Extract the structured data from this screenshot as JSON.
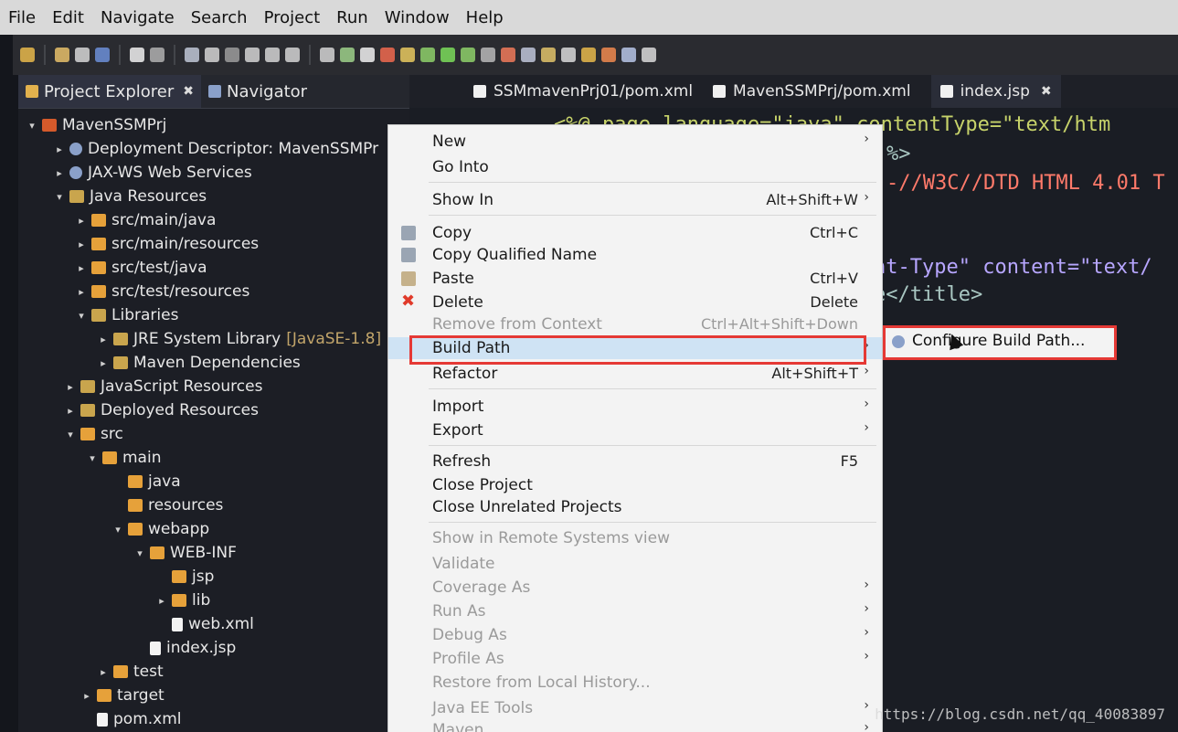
{
  "menubar": [
    "File",
    "Edit",
    "Navigate",
    "Search",
    "Project",
    "Run",
    "Window",
    "Help"
  ],
  "left_tabs": [
    {
      "label": "Project Explorer",
      "active": true,
      "close": "✖"
    },
    {
      "label": "Navigator",
      "active": false
    }
  ],
  "tree": [
    {
      "label": "MavenSSMPrj",
      "level": 0,
      "twisty": "▾",
      "icon": "project-icon"
    },
    {
      "label": "Deployment Descriptor: MavenSSMPr",
      "level": 1,
      "twisty": "▸",
      "icon": "gear-icon"
    },
    {
      "label": "JAX-WS Web Services",
      "level": 1,
      "twisty": "▸",
      "icon": "gear-icon"
    },
    {
      "label": "Java Resources",
      "level": 1,
      "twisty": "▾",
      "icon": "library-icon"
    },
    {
      "label": "src/main/java",
      "level": 2,
      "twisty": "▸",
      "icon": "package-folder-icon"
    },
    {
      "label": "src/main/resources",
      "level": 2,
      "twisty": "▸",
      "icon": "package-folder-icon"
    },
    {
      "label": "src/test/java",
      "level": 2,
      "twisty": "▸",
      "icon": "package-folder-icon"
    },
    {
      "label": "src/test/resources",
      "level": 2,
      "twisty": "▸",
      "icon": "package-folder-icon"
    },
    {
      "label": "Libraries",
      "level": 2,
      "twisty": "▾",
      "icon": "library-icon"
    },
    {
      "label": "JRE System Library",
      "suffix": " [JavaSE-1.8]",
      "level": 3,
      "twisty": "▸",
      "icon": "library-icon"
    },
    {
      "label": "Maven Dependencies",
      "level": 3,
      "twisty": "▸",
      "icon": "library-icon"
    },
    {
      "label": "JavaScript Resources",
      "level": 1,
      "twisty": "▸",
      "icon": "library-icon"
    },
    {
      "label": "Deployed Resources",
      "level": 1,
      "twisty": "▸",
      "icon": "library-icon"
    },
    {
      "label": "src",
      "level": 1,
      "twisty": "▾",
      "icon": "folder-icon"
    },
    {
      "label": "main",
      "level": 2,
      "twisty": "▾",
      "icon": "folder-icon"
    },
    {
      "label": "java",
      "level": 3,
      "twisty": "",
      "icon": "folder-icon"
    },
    {
      "label": "resources",
      "level": 3,
      "twisty": "",
      "icon": "folder-icon"
    },
    {
      "label": "webapp",
      "level": 3,
      "twisty": "▾",
      "icon": "folder-icon"
    },
    {
      "label": "WEB-INF",
      "level": 4,
      "twisty": "▾",
      "icon": "folder-icon"
    },
    {
      "label": "jsp",
      "level": 5,
      "twisty": "",
      "icon": "folder-icon"
    },
    {
      "label": "lib",
      "level": 5,
      "twisty": "▸",
      "icon": "folder-icon"
    },
    {
      "label": "web.xml",
      "level": 5,
      "twisty": "",
      "icon": "file-icon"
    },
    {
      "label": "index.jsp",
      "level": 4,
      "twisty": "",
      "icon": "file-icon"
    },
    {
      "label": "test",
      "level": 2,
      "twisty": "▸",
      "icon": "folder-icon"
    },
    {
      "label": "target",
      "level": 1,
      "twisty": "▸",
      "icon": "folder-icon"
    },
    {
      "label": "pom.xml",
      "level": 1,
      "twisty": "",
      "icon": "file-icon"
    }
  ],
  "editor_tabs": [
    {
      "label": "SSMmavenPrj01/pom.xml",
      "active": false
    },
    {
      "label": "MavenSSMPrj/pom.xml",
      "active": false
    },
    {
      "label": "index.jsp",
      "active": true,
      "close": "✖"
    }
  ],
  "code_lines": [
    {
      "text": "<%@ page language=\"java\" contentType=\"text/htm"
    },
    {
      "text": "%>"
    },
    {
      "text": "-//W3C//DTD HTML 4.01 T"
    },
    {
      "text": "nt-Type\" content=\"text/"
    },
    {
      "text": "e</title>"
    }
  ],
  "context_menu": [
    {
      "label": "New",
      "shortcut": "",
      "arrow": "›",
      "disabled": false,
      "icon": ""
    },
    {
      "label": "Go Into",
      "shortcut": "",
      "arrow": "",
      "disabled": false,
      "icon": ""
    },
    {
      "label": "Show In",
      "shortcut": "Alt+Shift+W",
      "arrow": "›",
      "disabled": false,
      "icon": ""
    },
    {
      "label": "Copy",
      "shortcut": "Ctrl+C",
      "arrow": "",
      "disabled": false,
      "icon": "copy"
    },
    {
      "label": "Copy Qualified Name",
      "shortcut": "",
      "arrow": "",
      "disabled": false,
      "icon": "copy"
    },
    {
      "label": "Paste",
      "shortcut": "Ctrl+V",
      "arrow": "",
      "disabled": false,
      "icon": "paste"
    },
    {
      "label": "Delete",
      "shortcut": "Delete",
      "arrow": "",
      "disabled": false,
      "icon": "del"
    },
    {
      "label": "Remove from Context",
      "shortcut": "Ctrl+Alt+Shift+Down",
      "arrow": "",
      "disabled": true,
      "icon": ""
    },
    {
      "label": "Build Path",
      "shortcut": "",
      "arrow": "›",
      "disabled": false,
      "icon": "",
      "highlight": true
    },
    {
      "label": "Refactor",
      "shortcut": "Alt+Shift+T",
      "arrow": "›",
      "disabled": false,
      "icon": ""
    },
    {
      "label": "Import",
      "shortcut": "",
      "arrow": "›",
      "disabled": false,
      "icon": ""
    },
    {
      "label": "Export",
      "shortcut": "",
      "arrow": "›",
      "disabled": false,
      "icon": ""
    },
    {
      "label": "Refresh",
      "shortcut": "F5",
      "arrow": "",
      "disabled": false,
      "icon": ""
    },
    {
      "label": "Close Project",
      "shortcut": "",
      "arrow": "",
      "disabled": false,
      "icon": ""
    },
    {
      "label": "Close Unrelated Projects",
      "shortcut": "",
      "arrow": "",
      "disabled": false,
      "icon": ""
    },
    {
      "label": "Show in Remote Systems view",
      "shortcut": "",
      "arrow": "",
      "disabled": true,
      "icon": ""
    },
    {
      "label": "Validate",
      "shortcut": "",
      "arrow": "",
      "disabled": true,
      "icon": ""
    },
    {
      "label": "Coverage As",
      "shortcut": "",
      "arrow": "›",
      "disabled": true,
      "icon": ""
    },
    {
      "label": "Run As",
      "shortcut": "",
      "arrow": "›",
      "disabled": true,
      "icon": ""
    },
    {
      "label": "Debug As",
      "shortcut": "",
      "arrow": "›",
      "disabled": true,
      "icon": ""
    },
    {
      "label": "Profile As",
      "shortcut": "",
      "arrow": "›",
      "disabled": true,
      "icon": ""
    },
    {
      "label": "Restore from Local History...",
      "shortcut": "",
      "arrow": "",
      "disabled": true,
      "icon": ""
    },
    {
      "label": "Java EE Tools",
      "shortcut": "",
      "arrow": "›",
      "disabled": true,
      "icon": ""
    },
    {
      "label": "Maven",
      "shortcut": "",
      "arrow": "›",
      "disabled": true,
      "icon": ""
    }
  ],
  "submenu": {
    "label": "Configure Build Path..."
  },
  "watermark": "https://blog.csdn.net/qq_40083897"
}
